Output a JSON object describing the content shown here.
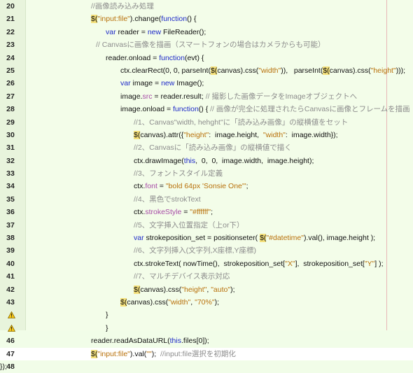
{
  "editor": {
    "lines": [
      {
        "number": "20",
        "code": [
          {
            "t": "//画像読み込み処理",
            "c": "cm"
          }
        ]
      },
      {
        "number": "21",
        "code": [
          {
            "t": "$(",
            "c": "hl"
          },
          {
            "t": "\"input:file\"",
            "c": "str"
          },
          {
            "t": ").change(",
            "c": ""
          },
          {
            "t": "function",
            "c": "kw"
          },
          {
            "t": "() {",
            "c": ""
          }
        ]
      },
      {
        "number": "22",
        "code": [
          {
            "t": "var",
            "c": "kw"
          },
          {
            "t": " reader = ",
            "c": ""
          },
          {
            "t": "new",
            "c": "kw"
          },
          {
            "t": " FileReader();",
            "c": ""
          }
        ]
      },
      {
        "number": "23",
        "code": [
          {
            "t": "// Canvasに画像を描画（スマートフォンの場合はカメラからも可能）",
            "c": "cm"
          }
        ]
      },
      {
        "number": "24",
        "code": [
          {
            "t": "reader.onload = ",
            "c": ""
          },
          {
            "t": "function",
            "c": "kw"
          },
          {
            "t": "(evt) {",
            "c": ""
          }
        ]
      },
      {
        "number": "25",
        "code": [
          {
            "t": "ctx.clearRect(0, 0, parseInt(",
            "c": ""
          },
          {
            "t": "$(",
            "c": "hl"
          },
          {
            "t": "canvas).css(",
            "c": ""
          },
          {
            "t": "\"width\"",
            "c": "str"
          },
          {
            "t": ")),   parseInt(",
            "c": ""
          },
          {
            "t": "$(",
            "c": "hl"
          },
          {
            "t": "canvas).css(",
            "c": ""
          },
          {
            "t": "\"height\"",
            "c": "str"
          },
          {
            "t": ")));",
            "c": ""
          }
        ]
      },
      {
        "number": "26",
        "code": [
          {
            "t": "var",
            "c": "kw"
          },
          {
            "t": " image = ",
            "c": ""
          },
          {
            "t": "new",
            "c": "kw"
          },
          {
            "t": " Image();",
            "c": ""
          }
        ]
      },
      {
        "number": "27",
        "code": [
          {
            "t": "image.",
            "c": ""
          },
          {
            "t": "src",
            "c": "prop"
          },
          {
            "t": " = reader.result; ",
            "c": ""
          },
          {
            "t": "// 撮影した画像データをImageオブジェクトへ",
            "c": "cm"
          }
        ]
      },
      {
        "number": "28",
        "code": [
          {
            "t": "image.onload = ",
            "c": ""
          },
          {
            "t": "function",
            "c": "kw"
          },
          {
            "t": "() { ",
            "c": ""
          },
          {
            "t": "// 画像が完全に処理されたらCanvasに画像とフレームを描画",
            "c": "cm"
          }
        ]
      },
      {
        "number": "29",
        "code": [
          {
            "t": "//1、Canvas\"width, hehght\"に「読み込み画像」の縦横値をセット",
            "c": "cm"
          }
        ]
      },
      {
        "number": "30",
        "code": [
          {
            "t": "$(",
            "c": "hl"
          },
          {
            "t": "canvas).attr({",
            "c": ""
          },
          {
            "t": "\"height\"",
            "c": "str"
          },
          {
            "t": ":  image.height,  ",
            "c": ""
          },
          {
            "t": "\"width\"",
            "c": "str"
          },
          {
            "t": ":  image.width});",
            "c": ""
          }
        ]
      },
      {
        "number": "31",
        "code": [
          {
            "t": "//2、Canvasに「読み込み画像」の縦横値で描く",
            "c": "cm"
          }
        ]
      },
      {
        "number": "32",
        "code": [
          {
            "t": "ctx.drawImage(",
            "c": ""
          },
          {
            "t": "this",
            "c": "kw"
          },
          {
            "t": ",  0,  0,  image.width,  image.height);",
            "c": ""
          }
        ]
      },
      {
        "number": "33",
        "code": [
          {
            "t": "//3、フォントスタイル定義",
            "c": "cm"
          }
        ]
      },
      {
        "number": "34",
        "code": [
          {
            "t": "ctx.",
            "c": ""
          },
          {
            "t": "font",
            "c": "prop"
          },
          {
            "t": " = ",
            "c": ""
          },
          {
            "t": "\"bold 64px 'Sonsie One'\"",
            "c": "str"
          },
          {
            "t": ";",
            "c": ""
          }
        ]
      },
      {
        "number": "35",
        "code": [
          {
            "t": "//4、黒色でstrokText",
            "c": "cm"
          }
        ]
      },
      {
        "number": "36",
        "code": [
          {
            "t": "ctx.",
            "c": ""
          },
          {
            "t": "strokeStyle",
            "c": "prop"
          },
          {
            "t": " = ",
            "c": ""
          },
          {
            "t": "\"#ffffff\"",
            "c": "str"
          },
          {
            "t": ";",
            "c": ""
          }
        ]
      },
      {
        "number": "37",
        "code": [
          {
            "t": "//5、文字挿入位置指定（上or下）",
            "c": "cm"
          }
        ]
      },
      {
        "number": "38",
        "code": [
          {
            "t": "var",
            "c": "kw"
          },
          {
            "t": " strokeposition_set = positionseter( ",
            "c": ""
          },
          {
            "t": "$(",
            "c": "hl"
          },
          {
            "t": "\"#datetime\"",
            "c": "str"
          },
          {
            "t": ").val(), image.height );",
            "c": ""
          }
        ]
      },
      {
        "number": "39",
        "code": [
          {
            "t": "//6、文字列挿入(文字列,X座標,Y座標)",
            "c": "cm"
          }
        ]
      },
      {
        "number": "40",
        "code": [
          {
            "t": "ctx.strokeText( nowTime(),  strokeposition_set[",
            "c": ""
          },
          {
            "t": "\"X\"",
            "c": "str"
          },
          {
            "t": "],  strokeposition_set[",
            "c": ""
          },
          {
            "t": "\"Y\"",
            "c": "str"
          },
          {
            "t": "] );",
            "c": ""
          }
        ]
      },
      {
        "number": "41",
        "code": [
          {
            "t": "//7、マルチデバイス表示対応",
            "c": "cm"
          }
        ]
      },
      {
        "number": "42",
        "code": [
          {
            "t": "$(",
            "c": "hl"
          },
          {
            "t": "canvas).css(",
            "c": ""
          },
          {
            "t": "\"height\"",
            "c": "str"
          },
          {
            "t": ", ",
            "c": ""
          },
          {
            "t": "\"auto\"",
            "c": "str"
          },
          {
            "t": ");",
            "c": ""
          }
        ]
      },
      {
        "number": "43",
        "code": [
          {
            "t": "$(",
            "c": "hl"
          },
          {
            "t": "canvas).css(",
            "c": ""
          },
          {
            "t": "\"width\"",
            "c": "str"
          },
          {
            "t": ", ",
            "c": ""
          },
          {
            "t": "\"70%\"",
            "c": "str"
          },
          {
            "t": ");",
            "c": ""
          }
        ]
      },
      {
        "number": "",
        "warning": true,
        "code": [
          {
            "t": "}",
            "c": ""
          }
        ]
      },
      {
        "number": "",
        "warning": true,
        "code": [
          {
            "t": "}",
            "c": ""
          }
        ]
      },
      {
        "number": "46",
        "code": [
          {
            "t": "reader.readAsDataURL(",
            "c": ""
          },
          {
            "t": "this",
            "c": "kw"
          },
          {
            "t": ".files[0]);",
            "c": ""
          }
        ]
      },
      {
        "number": "47",
        "current": true,
        "code": [
          {
            "t": "$(",
            "c": "hl"
          },
          {
            "t": "\"input:file\"",
            "c": "str"
          },
          {
            "t": ").val(",
            "c": ""
          },
          {
            "t": "\"\"",
            "c": "str"
          },
          {
            "t": ");  ",
            "c": ""
          },
          {
            "t": "//input:file選択を初期化",
            "c": "cm"
          }
        ]
      },
      {
        "number": "48",
        "code": [
          {
            "t": "});",
            "c": ""
          }
        ]
      }
    ]
  }
}
